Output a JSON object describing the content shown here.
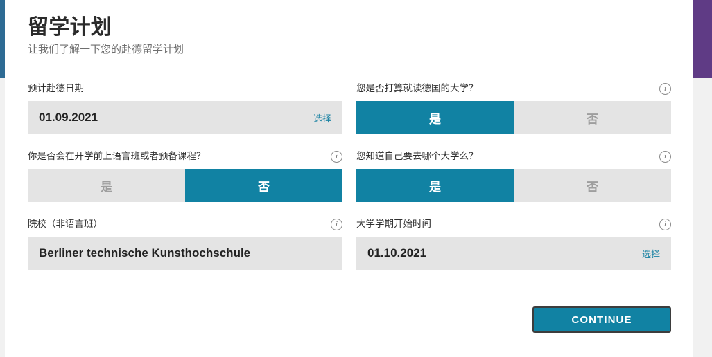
{
  "theme": {
    "accent_teal": "#1182a3",
    "left_bar_color": "#2e6b94",
    "right_bar_color": "#5f3b85",
    "field_bg": "#e4e4e4",
    "link_color": "#1b83a3"
  },
  "header": {
    "title": "留学计划",
    "subtitle": "让我们了解一下您的赴德留学计划"
  },
  "icons": {
    "info": "i"
  },
  "fields": {
    "arrival_date": {
      "label": "预计赴德日期",
      "value": "01.09.2021",
      "action": "选择"
    },
    "attend_university": {
      "label": "您是否打算就读德国的大学？",
      "yes": "是",
      "no": "否",
      "selected": "yes"
    },
    "language_course": {
      "label": "你是否会在开学前上语言班或者预备课程？",
      "yes": "是",
      "no": "否",
      "selected": "no"
    },
    "know_university": {
      "label": "您知道自己要去哪个大学么？",
      "yes": "是",
      "no": "否",
      "selected": "yes"
    },
    "institution": {
      "label": "院校（非语言班）",
      "value": "Berliner technische Kunsthochschule"
    },
    "semester_start": {
      "label": "大学学期开始时间",
      "value": "01.10.2021",
      "action": "选择"
    }
  },
  "footer": {
    "continue_label": "CONTINUE"
  }
}
